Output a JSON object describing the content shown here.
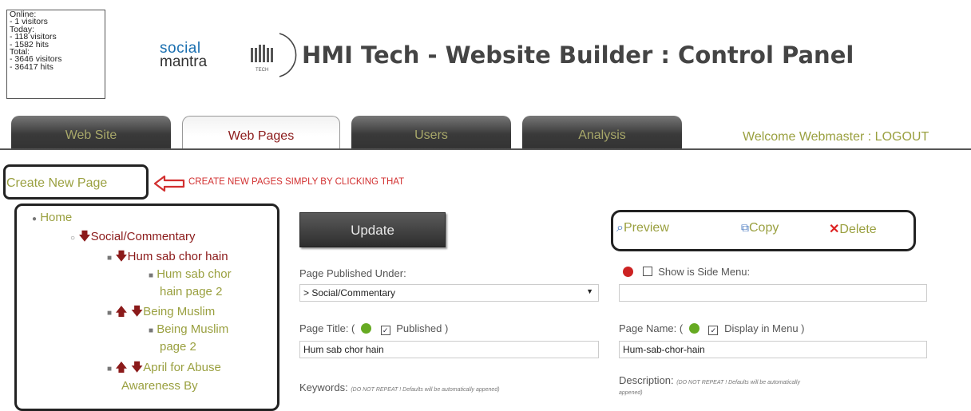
{
  "stats": {
    "lines": [
      "Online:",
      "- 1 visitors",
      "Today:",
      "- 118 visitors",
      "- 1582 hits",
      "Total:",
      "- 3646 visitors",
      "- 36417 hits"
    ]
  },
  "logo": {
    "social": "social",
    "mantra": "mantra",
    "emblem_text": "TECH"
  },
  "header": {
    "title": "HMI Tech - Website Builder : Control Panel"
  },
  "tabs": [
    {
      "label": "Web Site",
      "active": false
    },
    {
      "label": "Web Pages",
      "active": true
    },
    {
      "label": "Users",
      "active": false
    },
    {
      "label": "Analysis",
      "active": false
    }
  ],
  "welcome": "Welcome Webmaster : LOGOUT",
  "create_page": {
    "link": "Create New Page",
    "annotation": "CREATE NEW PAGES SIMPLY BY CLICKING THAT"
  },
  "tree": {
    "home": "Home",
    "social_commentary": "Social/Commentary",
    "hum_sab": "Hum sab chor hain",
    "hum_sab_2_line1": "Hum sab chor",
    "hum_sab_2_line2": "hain page 2",
    "being_muslim": "Being Muslim",
    "being_muslim_2_line1": "Being Muslim",
    "being_muslim_2_line2": "page 2",
    "april_line1": "April for Abuse",
    "april_line2": "Awareness By"
  },
  "form": {
    "update_label": "Update",
    "preview_label": "Preview",
    "copy_label": "Copy",
    "delete_label": "Delete",
    "published_under_label": "Page Published Under:",
    "published_under_value": "> Social/Commentary",
    "show_side_menu_label": "Show is Side Menu:",
    "page_title_label_prefix": "Page Title: (",
    "published_label": "Published )",
    "page_title_value": "Hum sab chor hain",
    "page_name_label_prefix": "Page Name: (",
    "display_in_menu_label": "Display in Menu )",
    "page_name_value": "Hum-sab-chor-hain",
    "keywords_label": "Keywords:",
    "keywords_note": "(DO NOT REPEAT ! Defaults will be automatically appened)",
    "description_label": "Description:",
    "description_note_line1": "(DO NOT REPEAT ! Defaults will be automatically",
    "description_note_line2": "appened)"
  },
  "colors": {
    "link_green": "#9aa040",
    "dark_red": "#8b1a1a",
    "annotation_red": "#d23030",
    "status_red": "#cc2222",
    "status_green": "#66aa22"
  }
}
